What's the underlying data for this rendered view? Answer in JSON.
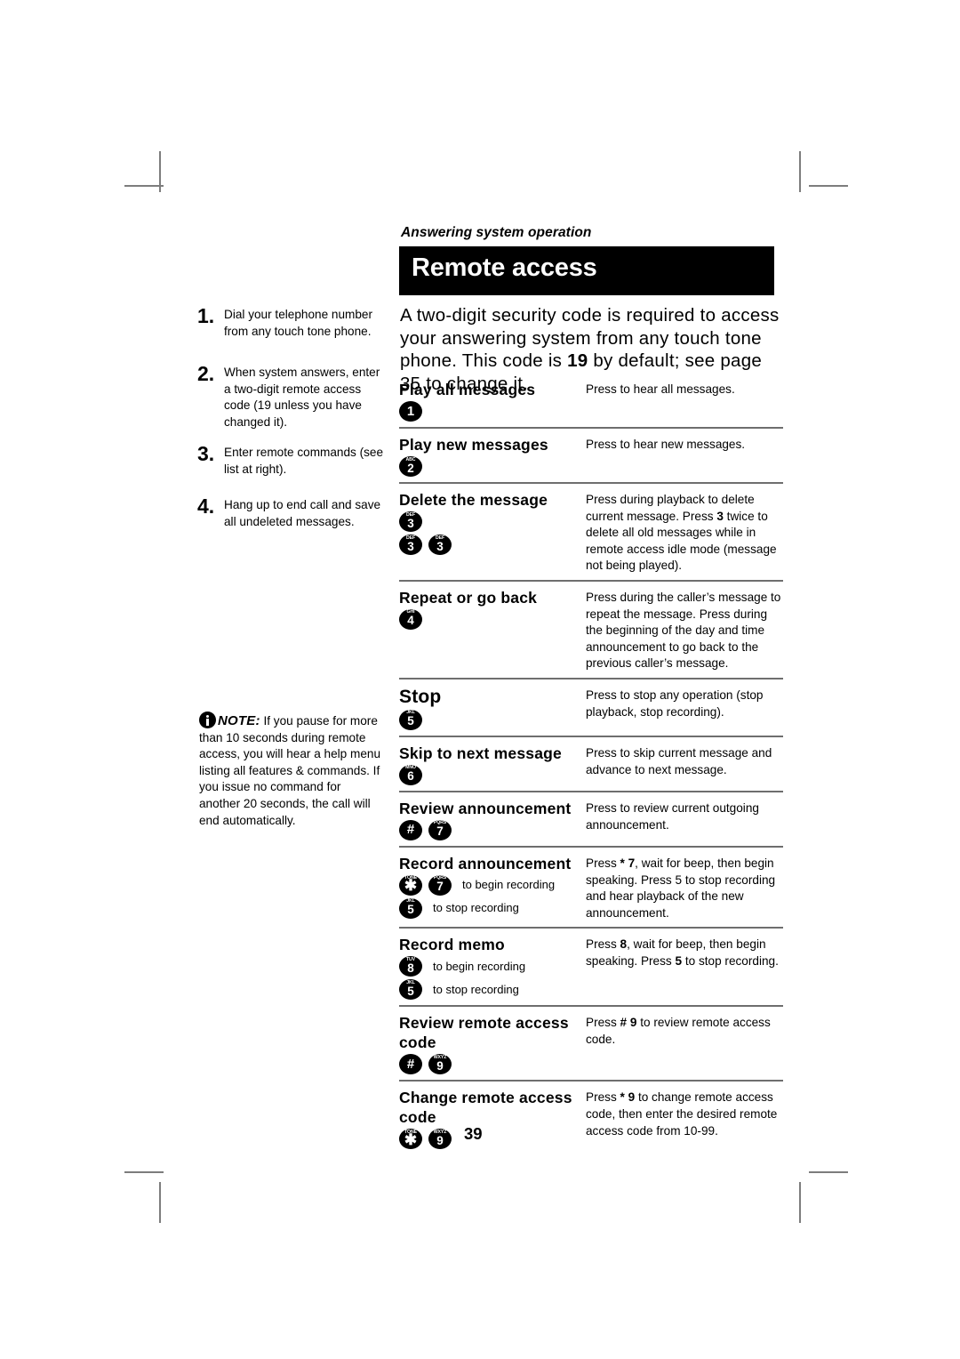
{
  "document": {
    "running_head": "Answering system operation",
    "section_title": "Remote access",
    "page_number": "39"
  },
  "intro": {
    "line1": "A two-digit security code is required to access",
    "line2": "your answering system from any touch tone phone.",
    "line3_a": "This code is ",
    "line3_b": "19",
    "line3_c": " by default; see page 35 to change it."
  },
  "steps": [
    {
      "number": "1.",
      "text": "Dial your telephone number from any touch tone phone."
    },
    {
      "number": "2.",
      "text": "When system answers, enter a two-digit remote access code (19 unless you have changed it)."
    },
    {
      "number": "3.",
      "text": "Enter remote commands (see list at right)."
    },
    {
      "number": "4.",
      "text": "Hang up to end call and save all undeleted messages."
    }
  ],
  "note": {
    "label": "NOTE:",
    "text": " If you pause for more than 10 seconds during remote access, you will hear a help menu listing all features & commands. If you issue no command for another 20 seconds, the call will end automatically."
  },
  "commands": [
    {
      "title": "Play all messages",
      "keys_lines": [
        {
          "keys": [
            {
              "digit": "1",
              "letters": ""
            }
          ],
          "note": ""
        }
      ],
      "description_parts": [
        {
          "text": "Press to hear all messages.",
          "bold": false
        }
      ]
    },
    {
      "title": "Play new messages",
      "keys_lines": [
        {
          "keys": [
            {
              "digit": "2",
              "letters": "ABC"
            }
          ],
          "note": ""
        }
      ],
      "description_parts": [
        {
          "text": "Press to hear new messages.",
          "bold": false
        }
      ]
    },
    {
      "title": "Delete the message",
      "keys_lines": [
        {
          "keys": [
            {
              "digit": "3",
              "letters": "DEF"
            }
          ],
          "note": ""
        },
        {
          "keys": [
            {
              "digit": "3",
              "letters": "DEF"
            },
            {
              "digit": "3",
              "letters": "DEF"
            }
          ],
          "note": ""
        }
      ],
      "description_parts": [
        {
          "text": "Press during playback to delete current message. Press ",
          "bold": false
        },
        {
          "text": "3",
          "bold": true
        },
        {
          "text": " twice to delete all old messages while in remote access idle mode (message not being played).",
          "bold": false
        }
      ]
    },
    {
      "title": "Repeat or go back",
      "keys_lines": [
        {
          "keys": [
            {
              "digit": "4",
              "letters": "GHI"
            }
          ],
          "note": ""
        }
      ],
      "description_parts": [
        {
          "text": "Press during the caller’s message to repeat the message. Press during the beginning of the day and time announcement to go back to the previous caller’s message.",
          "bold": false
        }
      ]
    },
    {
      "title": "Stop",
      "keys_lines": [
        {
          "keys": [
            {
              "digit": "5",
              "letters": "JKL"
            }
          ],
          "note": ""
        }
      ],
      "description_parts": [
        {
          "text": "Press to stop any operation (stop playback, stop recording).",
          "bold": false
        }
      ]
    },
    {
      "title": "Skip to next message",
      "keys_lines": [
        {
          "keys": [
            {
              "digit": "6",
              "letters": "MNO"
            }
          ],
          "note": ""
        }
      ],
      "description_parts": [
        {
          "text": "Press to skip current message and advance to next message.",
          "bold": false
        }
      ]
    },
    {
      "title": "Review announcement",
      "keys_lines": [
        {
          "keys": [
            {
              "digit": "#",
              "letters": ""
            },
            {
              "digit": "7",
              "letters": "PQRS"
            }
          ],
          "note": ""
        }
      ],
      "description_parts": [
        {
          "text": "Press to review current outgoing announcement.",
          "bold": false
        }
      ]
    },
    {
      "title": "Record announcement",
      "keys_lines": [
        {
          "keys": [
            {
              "digit": "✱",
              "letters": "TONE"
            },
            {
              "digit": "7",
              "letters": "PQRS"
            }
          ],
          "note": "to begin recording"
        },
        {
          "keys": [
            {
              "digit": "5",
              "letters": "JKL"
            }
          ],
          "note": "to stop recording"
        }
      ],
      "description_parts": [
        {
          "text": "Press ",
          "bold": false
        },
        {
          "text": "* 7",
          "bold": true
        },
        {
          "text": ", wait for beep, then begin speaking. Press 5 to stop recording and hear playback of the new announcement.",
          "bold": false
        }
      ]
    },
    {
      "title": "Record memo",
      "keys_lines": [
        {
          "keys": [
            {
              "digit": "8",
              "letters": "TUV"
            }
          ],
          "note": "to begin recording"
        },
        {
          "keys": [
            {
              "digit": "5",
              "letters": "JKL"
            }
          ],
          "note": "to stop recording"
        }
      ],
      "description_parts": [
        {
          "text": "Press ",
          "bold": false
        },
        {
          "text": "8",
          "bold": true
        },
        {
          "text": ", wait for beep, then begin speaking. Press ",
          "bold": false
        },
        {
          "text": "5",
          "bold": true
        },
        {
          "text": " to stop recording.",
          "bold": false
        }
      ]
    },
    {
      "title": "Review remote access code",
      "keys_lines": [
        {
          "keys": [
            {
              "digit": "#",
              "letters": ""
            },
            {
              "digit": "9",
              "letters": "WXYZ"
            }
          ],
          "note": ""
        }
      ],
      "description_parts": [
        {
          "text": "Press ",
          "bold": false
        },
        {
          "text": "# 9",
          "bold": true
        },
        {
          "text": " to review remote access code.",
          "bold": false
        }
      ]
    },
    {
      "title": "Change remote access code",
      "keys_lines": [
        {
          "keys": [
            {
              "digit": "✱",
              "letters": "TONE"
            },
            {
              "digit": "9",
              "letters": "WXYZ"
            }
          ],
          "note": ""
        }
      ],
      "description_parts": [
        {
          "text": "Press ",
          "bold": false
        },
        {
          "text": "* 9",
          "bold": true
        },
        {
          "text": " to change remote access code, then enter the desired remote access code from 10-99.",
          "bold": false
        }
      ]
    }
  ],
  "colors": {
    "title_band_bg": "#000000",
    "title_band_text": "#ffffff",
    "rule": "#6e6e6e",
    "cropmark": "#7d7d7d"
  }
}
